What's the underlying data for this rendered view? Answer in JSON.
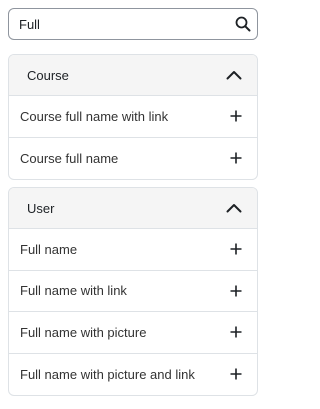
{
  "search": {
    "value": "Full",
    "icon": "search-icon"
  },
  "sections": [
    {
      "title": "Course",
      "expanded": true,
      "items": [
        {
          "label": "Course full name with link"
        },
        {
          "label": "Course full name"
        }
      ]
    },
    {
      "title": "User",
      "expanded": true,
      "items": [
        {
          "label": "Full name"
        },
        {
          "label": "Full name with link"
        },
        {
          "label": "Full name with picture"
        },
        {
          "label": "Full name with picture and link"
        }
      ]
    }
  ],
  "colors": {
    "border": "#dee2e6",
    "header_bg": "#f5f5f5",
    "text": "#333333",
    "icon": "#1d2125"
  }
}
